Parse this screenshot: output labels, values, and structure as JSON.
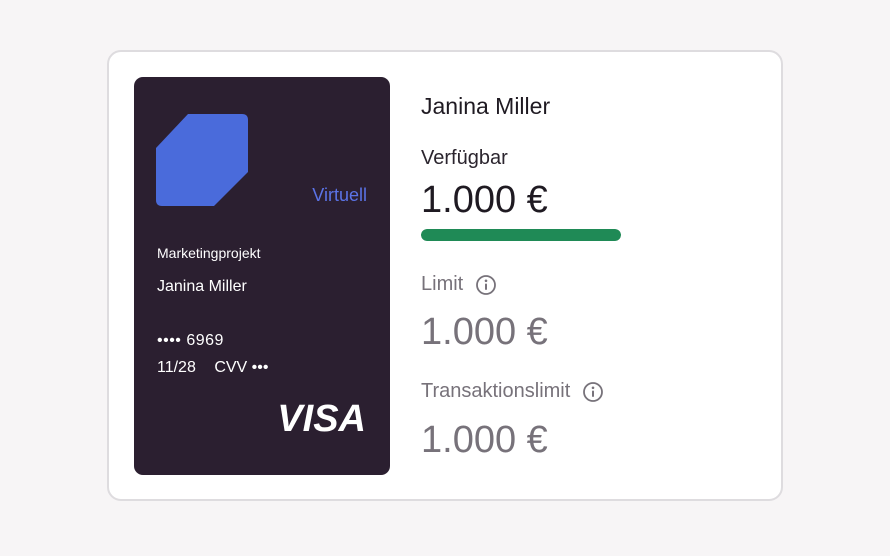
{
  "card": {
    "type_label": "Virtuell",
    "project": "Marketingprojekt",
    "holder": "Janina Miller",
    "number_masked": "•••• 6969",
    "expiry": "11/28",
    "cvv": "CVV •••",
    "brand": "VISA",
    "logo_icon": "card-logo-icon",
    "colors": {
      "background": "#2b1f30",
      "logo": "#4a6bdb",
      "type_label": "#5b73e6"
    }
  },
  "details": {
    "name": "Janina Miller",
    "available_label": "Verfügbar",
    "available_value": "1.000 €",
    "available_fraction": 1.0,
    "limit_label": "Limit",
    "limit_value": "1.000 €",
    "transaction_limit_label": "Transaktionslimit",
    "transaction_limit_value": "1.000 €",
    "info_icon": "info-icon",
    "colors": {
      "progress": "#1f8a56"
    }
  }
}
